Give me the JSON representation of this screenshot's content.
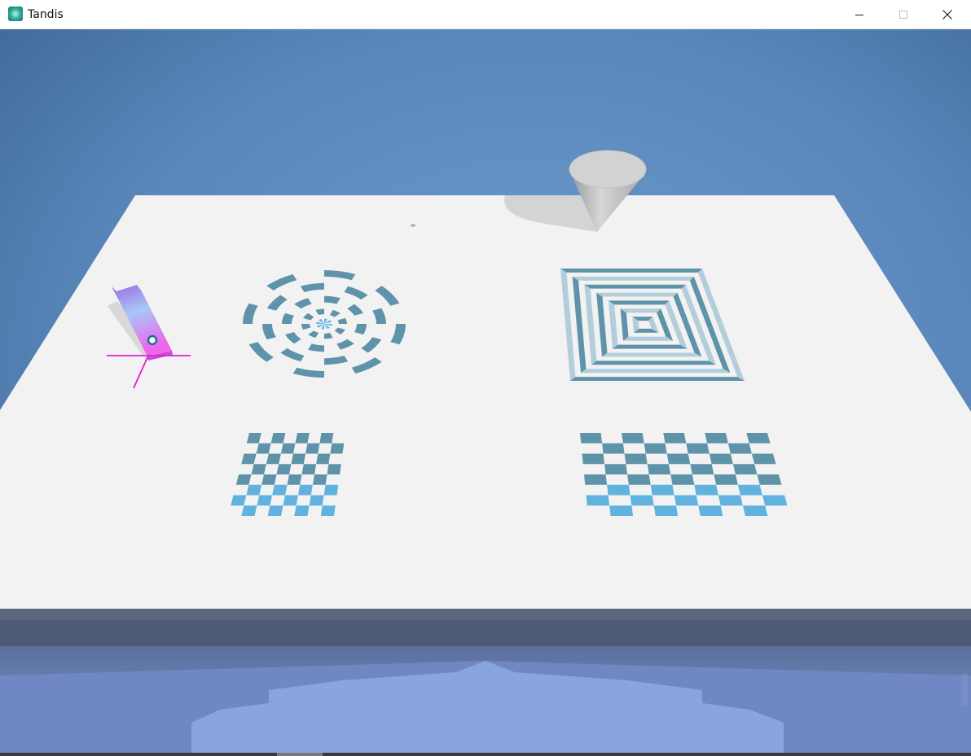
{
  "window": {
    "title": "Tandis",
    "app_icon": "flower-app-icon",
    "controls": {
      "minimize_icon": "minimize-icon",
      "maximize_icon": "maximize-icon",
      "close_icon": "close-icon"
    }
  },
  "scene": {
    "objects": [
      "cone",
      "robot-arm-tool",
      "polar-target",
      "square-spiral-target",
      "small-checkerboard",
      "large-checkerboard"
    ],
    "colors": {
      "sky_top": "#4a76a8",
      "sky_mid": "#6a98c8",
      "table": "#f2f2f2",
      "pattern_dark": "#5f93aa",
      "pattern_light": "#62b2e0",
      "floor": "#8aa5d8",
      "tool_gradient_top": "#9a6adf",
      "tool_gradient_mid": "#a8c6f8",
      "tool_gradient_bottom": "#ee66ee",
      "axis": "#e020d0"
    }
  }
}
